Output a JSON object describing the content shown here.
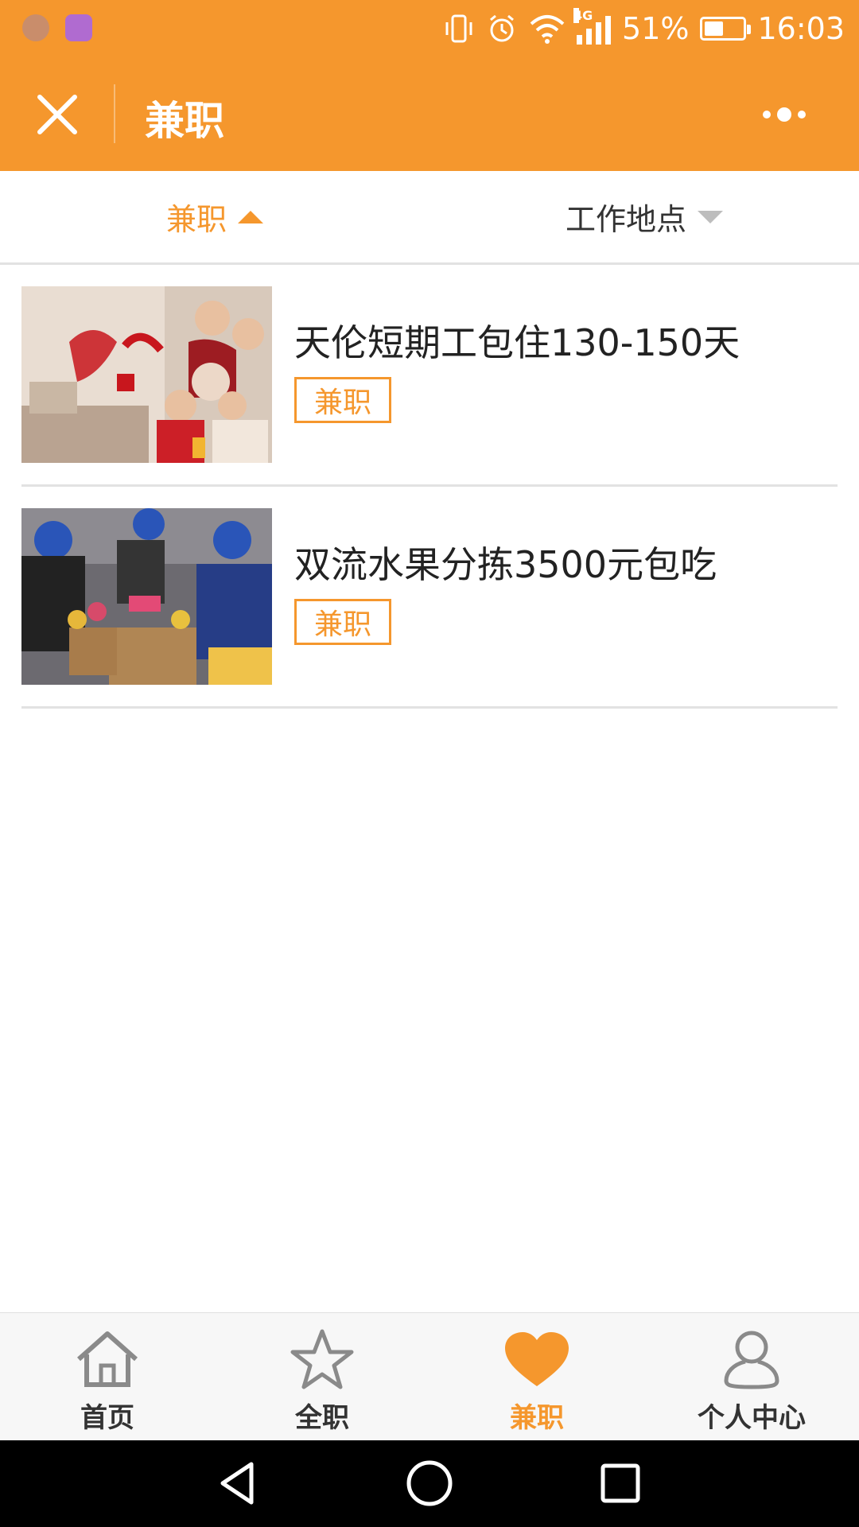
{
  "status_bar": {
    "battery_percent": "51%",
    "battery_level": 0.51,
    "time": "16:03",
    "network": "4G",
    "icons": [
      "app-badge-icon",
      "gallery-icon",
      "vibrate-icon",
      "alarm-icon",
      "wifi-icon",
      "signal-icon",
      "battery-icon"
    ]
  },
  "header": {
    "title": "兼职",
    "close_icon": "close-icon",
    "more_icon": "more-dots-icon"
  },
  "filters": [
    {
      "label": "兼职",
      "icon": "caret-up-icon",
      "active": true
    },
    {
      "label": "工作地点",
      "icon": "caret-down-icon",
      "active": false
    }
  ],
  "jobs": [
    {
      "title": "天伦短期工包住130-150天",
      "tag": "兼职",
      "image": "family-ad-photo"
    },
    {
      "title": "双流水果分拣3500元包吃",
      "tag": "兼职",
      "image": "fruit-sorting-photo"
    }
  ],
  "tabbar": [
    {
      "label": "首页",
      "icon": "home-icon",
      "active": false
    },
    {
      "label": "全职",
      "icon": "star-icon",
      "active": false
    },
    {
      "label": "兼职",
      "icon": "heart-icon",
      "active": true
    },
    {
      "label": "个人中心",
      "icon": "user-icon",
      "active": false
    }
  ],
  "nav": [
    "back-icon",
    "home-circle-icon",
    "recents-icon"
  ],
  "colors": {
    "accent": "#F5972D",
    "divider": "#e2e2e2",
    "tabbar_bg": "#f7f7f7"
  }
}
